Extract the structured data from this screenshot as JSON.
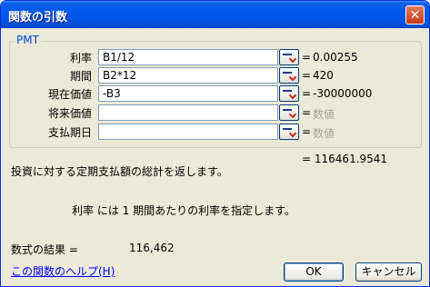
{
  "window": {
    "title": "関数の引数",
    "close_glyph": "✕"
  },
  "function_group": {
    "name": "PMT"
  },
  "args": [
    {
      "label": "利率",
      "value": "B1/12",
      "result": "0.00255"
    },
    {
      "label": "期間",
      "value": "B2*12",
      "result": "420"
    },
    {
      "label": "現在価値",
      "value": "-B3",
      "result": "-30000000"
    },
    {
      "label": "将来価値",
      "value": "",
      "result": "数値"
    },
    {
      "label": "支払期日",
      "value": "",
      "result": "数値"
    }
  ],
  "equals_sign": "=",
  "total_result": "116461.9541",
  "description": "投資に対する定期支払額の総計を返します。",
  "arg_help": "利率 には 1 期間あたりの利率を指定します。",
  "formula_result": {
    "label": "数式の結果 =",
    "value": "116,462"
  },
  "help_link": "この関数のヘルプ(H)",
  "buttons": {
    "ok": "OK",
    "cancel": "キャンセル"
  },
  "colors": {
    "titlebar": "#0054e3",
    "dialog_bg": "#ece9d8",
    "group_label": "#0046d5",
    "link": "#0000ff"
  }
}
